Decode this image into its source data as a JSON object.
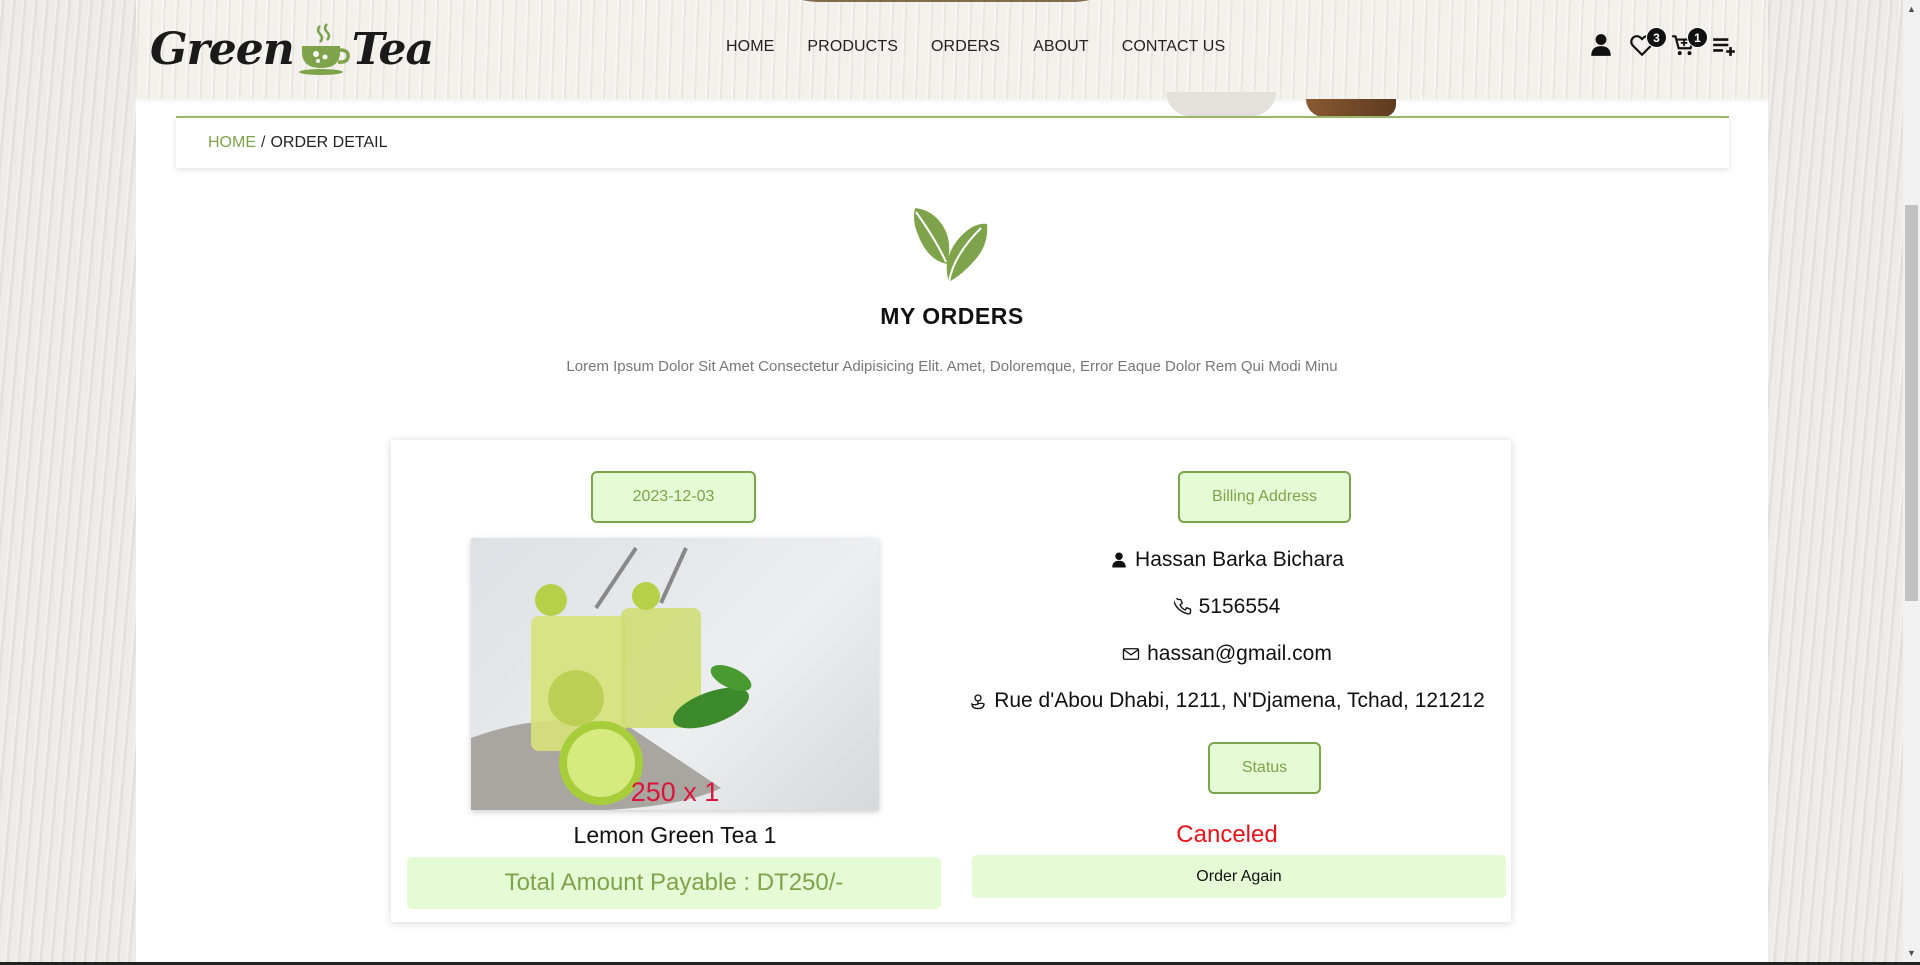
{
  "brand": {
    "word1": "Green",
    "word2": "Tea"
  },
  "nav": [
    "HOME",
    "PRODUCTS",
    "ORDERS",
    "ABOUT",
    "CONTACT US"
  ],
  "header_icons": {
    "user": "user-icon",
    "wishlist": {
      "icon": "heart-icon",
      "count": "3"
    },
    "cart": {
      "icon": "cart-icon",
      "count": "1"
    },
    "menu": "menu-add-icon"
  },
  "breadcrumb": {
    "home": "HOME",
    "separator": "/",
    "current": "ORDER DETAIL"
  },
  "section": {
    "title": "MY ORDERS",
    "subtitle": "Lorem Ipsum Dolor Sit Amet Consectetur Adipisicing Elit. Amet, Doloremque, Error Eaque Dolor Rem Qui Modi Minu"
  },
  "order": {
    "date": "2023-12-03",
    "quantity": "250 x 1",
    "product_name": "Lemon Green Tea 1",
    "total": "Total Amount Payable : DT250/-",
    "billing_label": "Billing Address",
    "name": "Hassan Barka Bichara",
    "phone": "5156554",
    "email": "hassan@gmail.com",
    "address": "Rue d'Abou Dhabi, 1211, N'Djamena, Tchad, 121212",
    "status_label": "Status",
    "status": "Canceled",
    "order_again": "Order Again"
  },
  "colors": {
    "accent": "#7ea34a",
    "pill_bg": "#e4fbd5",
    "status_canceled": "#e8141a",
    "quantity": "#dc143c"
  }
}
